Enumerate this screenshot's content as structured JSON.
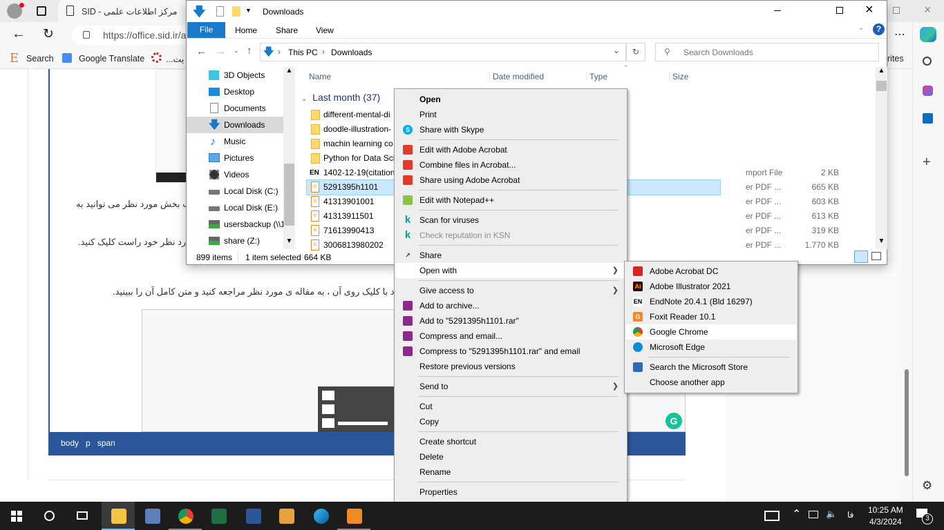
{
  "browser": {
    "tab_title": "SID - مرکز اطلاعات علمی",
    "url": "https://office.sid.ir/a",
    "bookmarks": [
      {
        "label": "Search",
        "icon": "e-icon"
      },
      {
        "label": "Google Translate",
        "icon": "google-translate-icon"
      },
      {
        "label": "...یت",
        "icon": "gear-logo-icon"
      }
    ],
    "favorites_fragment": "rites",
    "page": {
      "text_lines": [
        "ب بخش مورد نظر می توانید به",
        "رد نظر خود راست کلیک کنید.",
        "د با کلیک روی آن ، به مقاله ی مورد نظر مراجعه کنید و متن کامل آن را ببینید."
      ],
      "editor_path": [
        "body",
        "p",
        "span"
      ]
    }
  },
  "explorer": {
    "title": "Downloads",
    "ribbon_tabs": [
      "File",
      "Home",
      "Share",
      "View"
    ],
    "breadcrumb": [
      "This PC",
      "Downloads"
    ],
    "search_placeholder": "Search Downloads",
    "nav_items": [
      "3D Objects",
      "Desktop",
      "Documents",
      "Downloads",
      "Music",
      "Pictures",
      "Videos",
      "Local Disk (C:)",
      "Local Disk (E:)",
      "usersbackup (\\\\1",
      "share (Z:)"
    ],
    "nav_selected": "Downloads",
    "columns": [
      "Name",
      "Date modified",
      "Type",
      "Size"
    ],
    "group_label": "Last month (37)",
    "files": [
      {
        "name": "different-mental-di",
        "type": "",
        "size": "",
        "icon": "folder"
      },
      {
        "name": "doodle-illustration-",
        "type": "",
        "size": "",
        "icon": "folder"
      },
      {
        "name": "machin learning co",
        "type": "",
        "size": "",
        "icon": "folder"
      },
      {
        "name": "Python for Data Sci",
        "type": "",
        "size": "",
        "icon": "folder"
      },
      {
        "name": "1402-12-19(citation",
        "type": "mport File",
        "size": "2 KB",
        "icon": "endnote"
      },
      {
        "name": "5291395h1101",
        "type": "er PDF ...",
        "size": "665 KB",
        "icon": "pdf",
        "selected": true
      },
      {
        "name": "41313901001",
        "type": "er PDF ...",
        "size": "603 KB",
        "icon": "pdf"
      },
      {
        "name": "41313911501",
        "type": "er PDF ...",
        "size": "613 KB",
        "icon": "pdf"
      },
      {
        "name": "71613990413",
        "type": "er PDF ...",
        "size": "319 KB",
        "icon": "pdf"
      },
      {
        "name": "3006813980202",
        "type": "er PDF ...",
        "size": "1.770 KB",
        "icon": "pdf"
      }
    ],
    "status": {
      "items": "899 items",
      "selected": "1 item selected",
      "size": "664 KB"
    }
  },
  "context_menu": [
    {
      "label": "Open",
      "bold": true
    },
    {
      "label": "Print"
    },
    {
      "label": "Share with Skype",
      "icon": "skype"
    },
    {
      "sep": true
    },
    {
      "label": "Edit with Adobe Acrobat",
      "icon": "acrobat"
    },
    {
      "label": "Combine files in Acrobat...",
      "icon": "acrobat"
    },
    {
      "label": "Share using Adobe Acrobat",
      "icon": "acrobat"
    },
    {
      "sep": true
    },
    {
      "label": "Edit with Notepad++",
      "icon": "notepad"
    },
    {
      "sep": true
    },
    {
      "label": "Scan for viruses",
      "icon": "kaspersky"
    },
    {
      "label": "Check reputation in KSN",
      "icon": "kaspersky",
      "disabled": true
    },
    {
      "sep": true
    },
    {
      "label": "Share",
      "icon": "share"
    },
    {
      "label": "Open with",
      "submenu": true,
      "highlighted": true
    },
    {
      "sep": true
    },
    {
      "label": "Give access to",
      "submenu": true
    },
    {
      "label": "Add to archive...",
      "icon": "winrar"
    },
    {
      "label": "Add to \"5291395h1101.rar\"",
      "icon": "winrar"
    },
    {
      "label": "Compress and email...",
      "icon": "winrar"
    },
    {
      "label": "Compress to \"5291395h1101.rar\" and email",
      "icon": "winrar"
    },
    {
      "label": "Restore previous versions"
    },
    {
      "sep": true
    },
    {
      "label": "Send to",
      "submenu": true
    },
    {
      "sep": true
    },
    {
      "label": "Cut"
    },
    {
      "label": "Copy"
    },
    {
      "sep": true
    },
    {
      "label": "Create shortcut"
    },
    {
      "label": "Delete"
    },
    {
      "label": "Rename"
    },
    {
      "sep": true
    },
    {
      "label": "Properties"
    }
  ],
  "open_with_menu": [
    {
      "label": "Adobe Acrobat DC",
      "icon": "acrobat-dc",
      "color": "#d7261d"
    },
    {
      "label": "Adobe Illustrator 2021",
      "icon": "illustrator",
      "color": "#330000"
    },
    {
      "label": "EndNote 20.4.1 (Bld 16297)",
      "icon": "endnote",
      "color": "#ffffff"
    },
    {
      "label": "Foxit Reader 10.1",
      "icon": "foxit",
      "color": "#f08a24"
    },
    {
      "label": "Google Chrome",
      "icon": "chrome",
      "color": "#4285f4",
      "highlighted": true
    },
    {
      "label": "Microsoft Edge",
      "icon": "edge",
      "color": "#0c8bd6"
    },
    {
      "sep": true
    },
    {
      "label": "Search the Microsoft Store",
      "icon": "store",
      "color": "#2d6cb5"
    },
    {
      "label": "Choose another app"
    }
  ],
  "taskbar": {
    "apps": [
      "start",
      "search",
      "task-view",
      "file-explorer",
      "remote-desktop",
      "chrome",
      "excel",
      "word",
      "tools",
      "edge",
      "foxit"
    ],
    "language": "فا",
    "time": "10:25 AM",
    "date": "4/3/2024",
    "notifications": "3"
  },
  "colors": {
    "accent": "#1979ca",
    "editor_bar": "#2b579a",
    "taskbar": "#1c1c1c",
    "menu_bg": "#eeeeee"
  }
}
